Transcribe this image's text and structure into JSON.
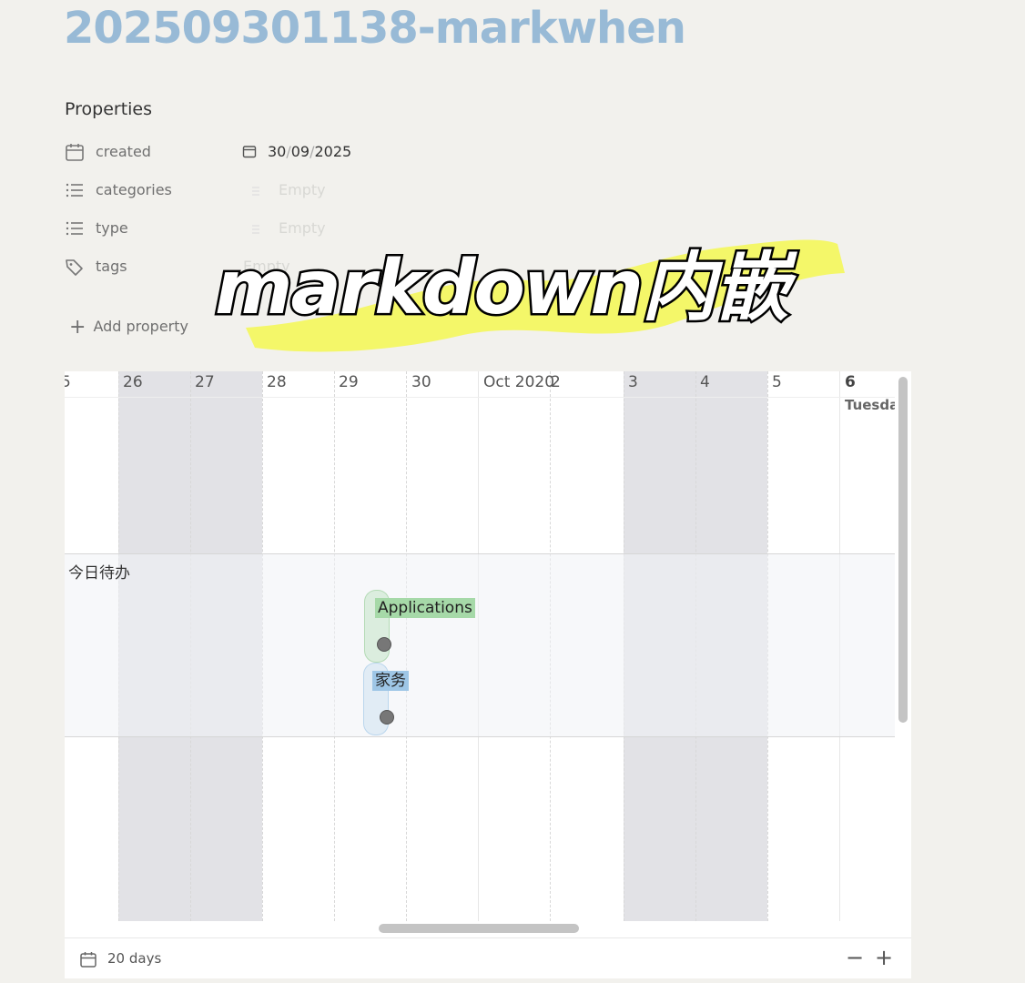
{
  "title": "202509301138-markwhen",
  "properties": {
    "heading": "Properties",
    "items": [
      {
        "icon": "calendar-icon",
        "label": "created",
        "value_parts": [
          "30",
          "/",
          "09",
          "/",
          "2025"
        ]
      },
      {
        "icon": "list-icon",
        "label": "categories",
        "value": "Empty"
      },
      {
        "icon": "list-icon",
        "label": "type",
        "value": "Empty"
      },
      {
        "icon": "tag-icon",
        "label": "tags",
        "value": "Empty"
      }
    ],
    "add_label": "Add property"
  },
  "overlay_text": "markdown内嵌",
  "timeline": {
    "dates": [
      "5",
      "26",
      "27",
      "28",
      "29",
      "30",
      "Oct 2020",
      "2",
      "3",
      "4",
      "5",
      "6"
    ],
    "day_name": "Tuesda",
    "group": "今日待办",
    "events": [
      {
        "label": "Applications",
        "color": "#a6d9a8"
      },
      {
        "label": "家务",
        "color": "#9ec6e6"
      }
    ],
    "range_label": "20 days",
    "zoom_out": "−",
    "zoom_in": "+"
  },
  "colors": {
    "title": "#98bad6",
    "highlight": "#f4f75a",
    "weekend": "#e2e2e6",
    "event_green": "#a6d9a8",
    "event_blue": "#9ec6e6"
  }
}
